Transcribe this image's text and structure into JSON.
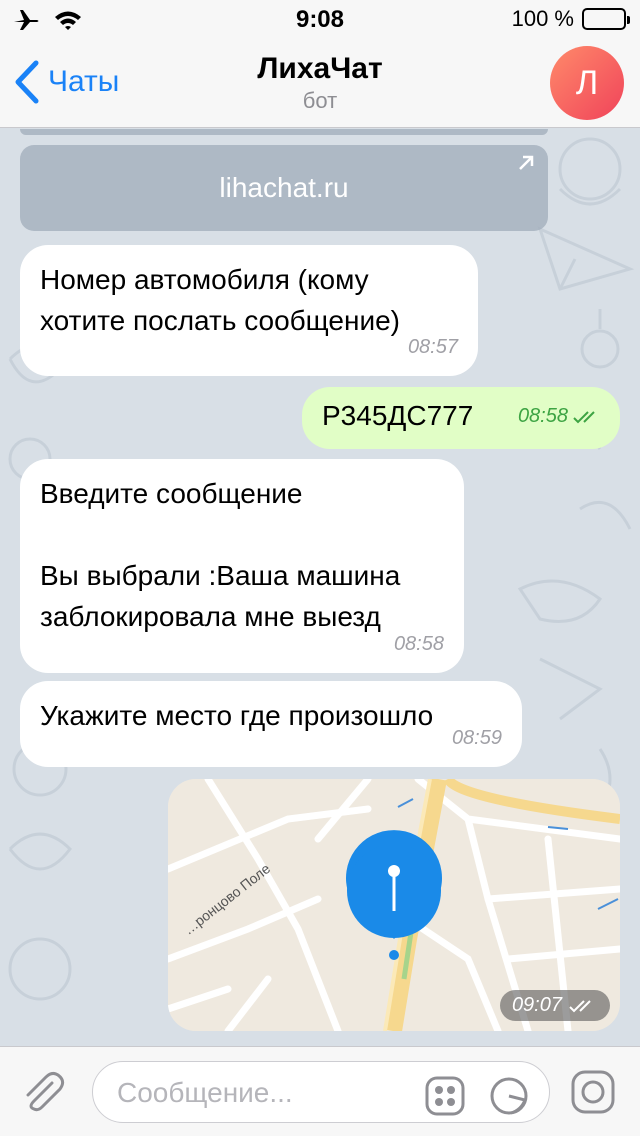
{
  "status_bar": {
    "time": "9:08",
    "battery_text": "100 %"
  },
  "nav": {
    "back_label": "Чаты",
    "title": "ЛихаЧат",
    "subtitle": "бот",
    "avatar_letter": "Л"
  },
  "link_preview": {
    "text": "lihachat.ru"
  },
  "messages": [
    {
      "direction": "in",
      "text": "Номер автомобиля (кому хотите послать сообщение)",
      "time": "08:57"
    },
    {
      "direction": "out",
      "text": "Р345ДС777",
      "time": "08:58"
    },
    {
      "direction": "in",
      "line1": "Введите сообщение",
      "line2": "Вы выбрали :Ваша машина заблокировала мне выезд",
      "time": "08:58"
    },
    {
      "direction": "in",
      "text": "Укажите место где произошло",
      "time": "08:59"
    }
  ],
  "location": {
    "street_label": "…ронцово Поле",
    "time": "09:07"
  },
  "input": {
    "placeholder": "Сообщение..."
  },
  "colors": {
    "accent": "#1a82f7",
    "outgoing_bubble": "#e1fec6",
    "pin": "#1a8ae8"
  }
}
